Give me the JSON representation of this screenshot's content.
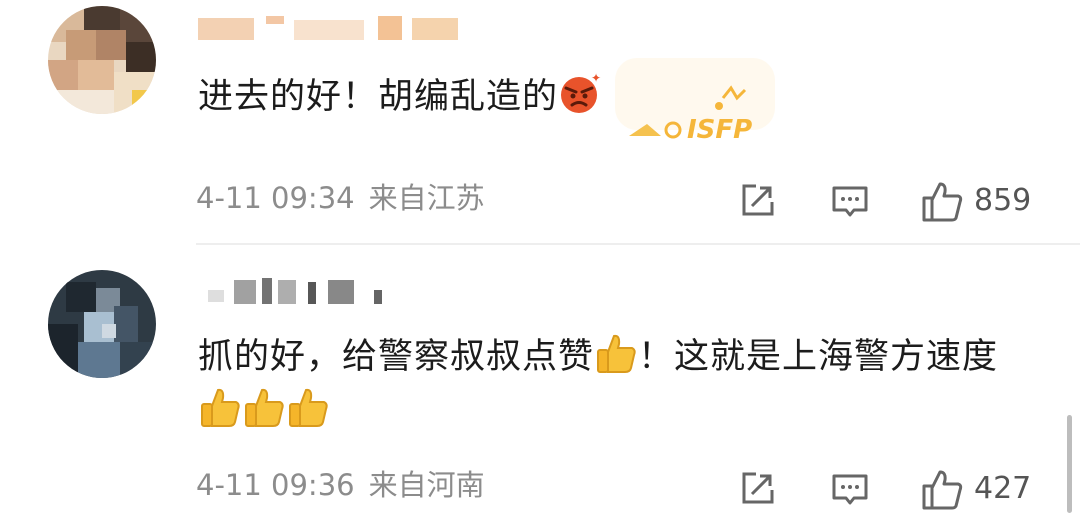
{
  "comments": [
    {
      "text_parts": [
        "进去的好！胡编乱造的"
      ],
      "time": "4-11 09:34",
      "location": "来自江苏",
      "likes": "859",
      "emoji": "angry-face",
      "badge_text": "ISFP"
    },
    {
      "text_parts": [
        "抓的好，给警察叔叔点赞",
        "！这就是上海警方速度"
      ],
      "time": "4-11 09:36",
      "location": "来自河南",
      "likes": "427",
      "emoji": "thumbs-up"
    }
  ],
  "colors": {
    "text": "#1c1c1c",
    "meta": "#8c8c8c",
    "icon": "#666666",
    "badge": "#f5b63a"
  }
}
